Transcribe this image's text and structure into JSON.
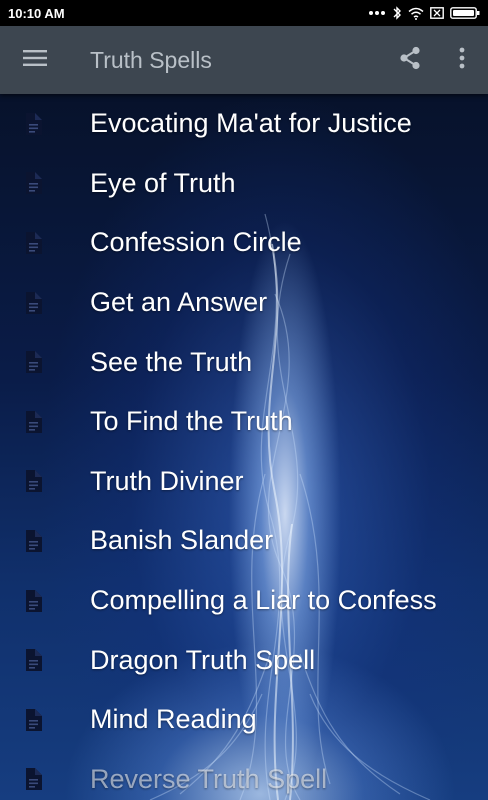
{
  "status_bar": {
    "time": "10:10 AM"
  },
  "app_bar": {
    "title": "Truth Spells",
    "menu_icon": "hamburger-menu-icon",
    "share_icon": "share-icon",
    "more_icon": "more-vert-icon"
  },
  "spells": [
    {
      "label": "Evocating Ma'at for Justice"
    },
    {
      "label": "Eye of Truth"
    },
    {
      "label": "Confession Circle"
    },
    {
      "label": "Get an Answer"
    },
    {
      "label": "See the Truth"
    },
    {
      "label": "To Find the Truth"
    },
    {
      "label": "Truth Diviner"
    },
    {
      "label": "Banish Slander"
    },
    {
      "label": "Compelling a Liar to Confess"
    },
    {
      "label": "Dragon Truth Spell"
    },
    {
      "label": "Mind Reading"
    },
    {
      "label": "Reverse Truth Spell"
    }
  ],
  "colors": {
    "app_bar": "#3d4650",
    "title_text": "#b9c0c7",
    "list_text": "#ffffff",
    "doc_icon": "#0b1430"
  }
}
